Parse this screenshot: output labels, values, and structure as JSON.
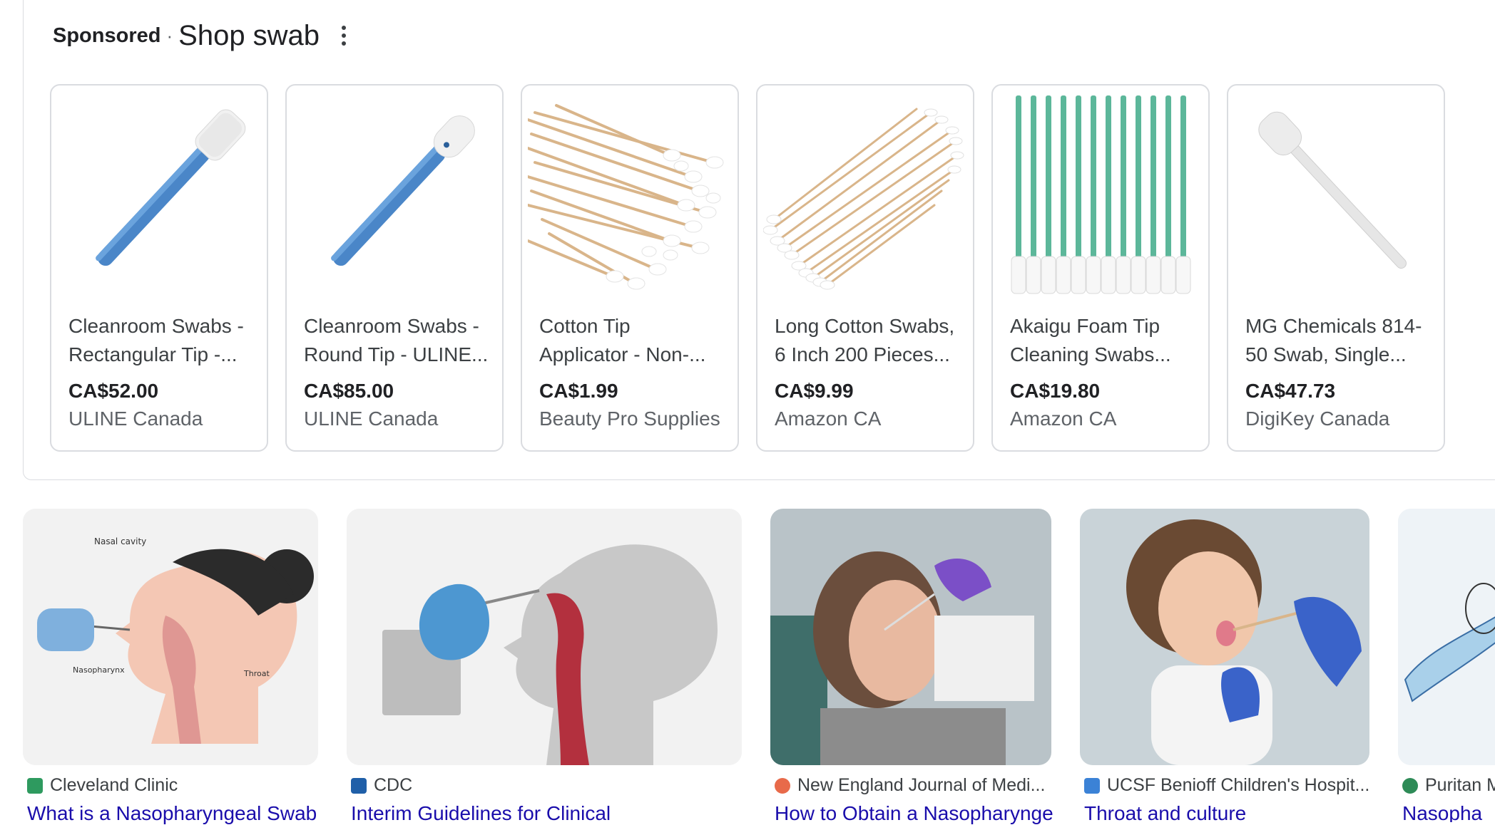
{
  "shop": {
    "sponsored_label": "Sponsored",
    "separator": "·",
    "title": "Shop swab",
    "menu_icon": "more-vertical-icon",
    "cards": [
      {
        "title_line1": "Cleanroom Swabs -",
        "title_line2": "Rectangular Tip -...",
        "price": "CA$52.00",
        "seller": "ULINE Canada",
        "image": "blue-foam-swab-rectangular"
      },
      {
        "title_line1": "Cleanroom Swabs -",
        "title_line2": "Round Tip - ULINE...",
        "price": "CA$85.00",
        "seller": "ULINE Canada",
        "image": "blue-foam-swab-round"
      },
      {
        "title_line1": "Cotton Tip",
        "title_line2": "Applicator - Non-...",
        "price": "CA$1.99",
        "seller": "Beauty Pro Supplies",
        "image": "cotton-tip-applicators-pile"
      },
      {
        "title_line1": "Long Cotton Swabs,",
        "title_line2": "6 Inch 200 Pieces...",
        "price": "CA$9.99",
        "seller": "Amazon CA",
        "image": "long-cotton-swabs-bundle"
      },
      {
        "title_line1": "Akaigu Foam Tip",
        "title_line2": "Cleaning Swabs...",
        "price": "CA$19.80",
        "seller": "Amazon CA",
        "image": "green-foam-swabs-row"
      },
      {
        "title_line1": "MG Chemicals 814-",
        "title_line2": "50 Swab, Single...",
        "price": "CA$47.73",
        "seller": "DigiKey Canada",
        "image": "white-foam-swab"
      }
    ]
  },
  "images": [
    {
      "source": "Cleveland Clinic",
      "caption": "What is a Nasopharyngeal Swab",
      "favicon_color": "#2e9a5f"
    },
    {
      "source": "CDC",
      "caption": "Interim Guidelines for Clinical",
      "favicon_color": "#1f5fa8"
    },
    {
      "source": "New England Journal of Medi...",
      "caption": "How to Obtain a Nasopharyngeal",
      "favicon_color": "#e86a4a"
    },
    {
      "source": "UCSF Benioff Children's Hospit...",
      "caption": "Throat and culture",
      "favicon_color": "#3b82d6"
    },
    {
      "source": "Puritan M",
      "caption": "Nasopha",
      "favicon_color": "#2e8b57"
    }
  ],
  "colors": {
    "link": "#1a0dab",
    "border": "#dadce0",
    "price": "#202124"
  }
}
